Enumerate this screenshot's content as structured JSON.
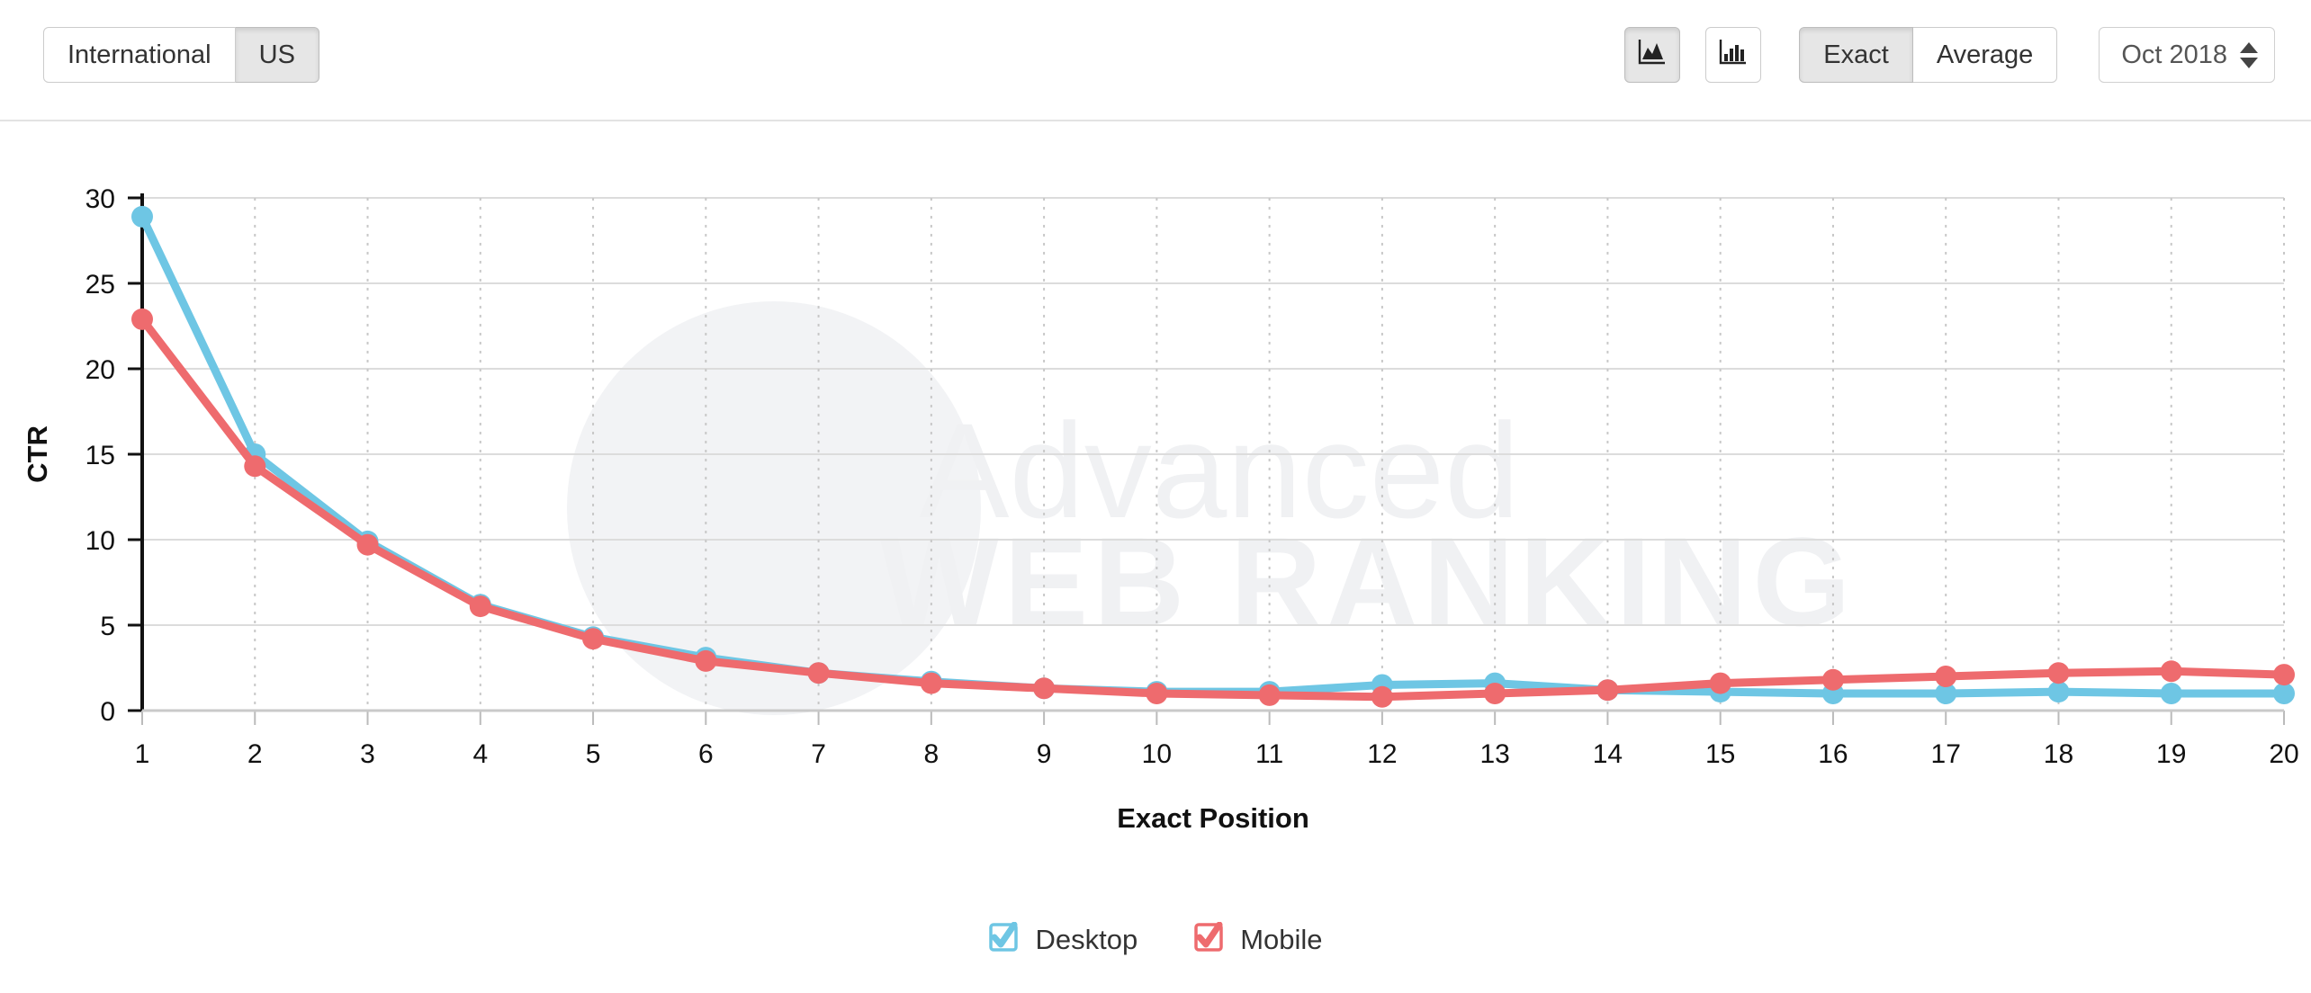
{
  "toolbar": {
    "region_buttons": [
      {
        "label": "International",
        "active": false
      },
      {
        "label": "US",
        "active": true
      }
    ],
    "chart_type_buttons": [
      {
        "icon": "area-chart-icon",
        "active": true
      },
      {
        "icon": "bar-chart-icon",
        "active": false
      }
    ],
    "mode_buttons": [
      {
        "label": "Exact",
        "active": true
      },
      {
        "label": "Average",
        "active": false
      }
    ],
    "date_select": {
      "value": "Oct 2018",
      "icon": "stepper-updown-icon"
    }
  },
  "watermark": {
    "line1": "Advanced",
    "line2": "WEB RANKING"
  },
  "legend": [
    {
      "label": "Desktop",
      "color": "#6EC6E4",
      "checked": true
    },
    {
      "label": "Mobile",
      "color": "#EE6B6E",
      "checked": true
    }
  ],
  "chart_data": {
    "type": "line",
    "title": "",
    "xlabel": "Exact Position",
    "ylabel": "CTR",
    "x": [
      1,
      2,
      3,
      4,
      5,
      6,
      7,
      8,
      9,
      10,
      11,
      12,
      13,
      14,
      15,
      16,
      17,
      18,
      19,
      20
    ],
    "xticks": [
      "1",
      "2",
      "3",
      "4",
      "5",
      "6",
      "7",
      "8",
      "9",
      "10",
      "11",
      "12",
      "13",
      "14",
      "15",
      "16",
      "17",
      "18",
      "19",
      "20"
    ],
    "yticks": [
      0,
      5,
      10,
      15,
      20,
      25,
      30
    ],
    "ylim": [
      0,
      30
    ],
    "xlim": [
      1,
      20
    ],
    "grid": true,
    "legend_position": "bottom",
    "series": [
      {
        "name": "Desktop",
        "color": "#6EC6E4",
        "values": [
          28.9,
          15.0,
          9.9,
          6.2,
          4.3,
          3.1,
          2.2,
          1.7,
          1.3,
          1.1,
          1.1,
          1.5,
          1.6,
          1.2,
          1.1,
          1.0,
          1.0,
          1.1,
          1.0,
          1.0
        ]
      },
      {
        "name": "Mobile",
        "color": "#EE6B6E",
        "values": [
          22.9,
          14.3,
          9.7,
          6.1,
          4.2,
          2.9,
          2.2,
          1.6,
          1.3,
          1.0,
          0.9,
          0.8,
          1.0,
          1.2,
          1.6,
          1.8,
          2.0,
          2.2,
          2.3,
          2.1
        ]
      }
    ]
  }
}
